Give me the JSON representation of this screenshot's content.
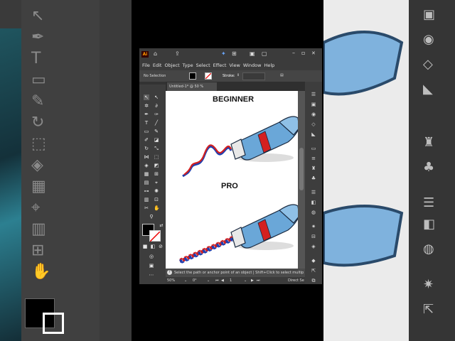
{
  "app": {
    "logo": "Ai",
    "menu": [
      "File",
      "Edit",
      "Object",
      "Type",
      "Select",
      "Effect",
      "View",
      "Window",
      "Help"
    ],
    "control_bar": {
      "selection_label": "No Selection",
      "stroke_label": "Stroke:"
    },
    "doc_tab": "Untitled-1* @ 50 % (RGB/Preview)",
    "artboard": {
      "heading_top": "BEGINNER",
      "heading_bottom": "PRO"
    },
    "hint_text": "Select the path or anchor point of an object | Shift+Click to select multiple",
    "status": {
      "zoom": "50%",
      "rotation": "0°",
      "artboard_num": "1",
      "mode": "Direct Se"
    },
    "window_controls": {
      "minimize": "–",
      "maximize": "▫",
      "close": "✕"
    }
  },
  "colors": {
    "app_bg": "#535353",
    "toothpaste_red": "#d42020",
    "toothpaste_blue": "#1f3fb0",
    "tube_blue": "#6aa7d8"
  }
}
